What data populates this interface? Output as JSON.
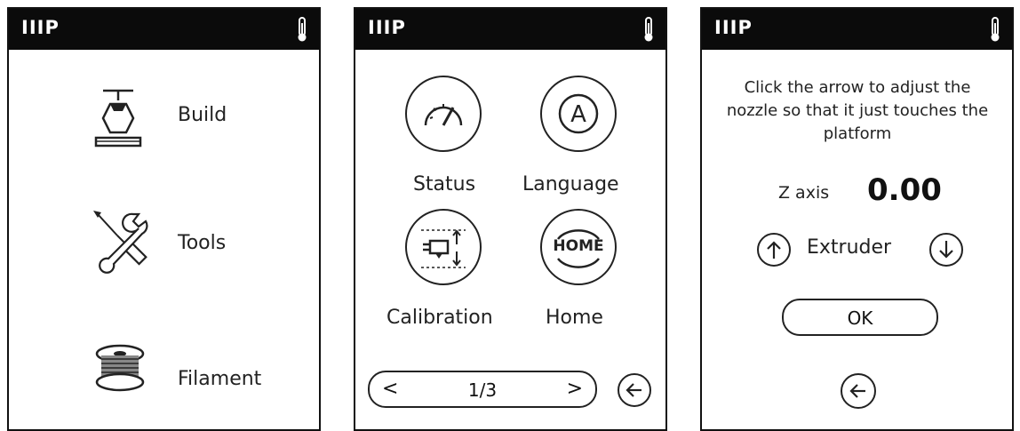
{
  "status_bar": {
    "brand": "IIIP",
    "thermometer_icon": "thermometer-icon"
  },
  "screen1": {
    "items": [
      {
        "label": "Build",
        "icon": "nozzle-build-icon"
      },
      {
        "label": "Tools",
        "icon": "wrench-screwdriver-icon"
      },
      {
        "label": "Filament",
        "icon": "filament-spool-icon"
      }
    ]
  },
  "screen2": {
    "items": [
      {
        "label": "Status",
        "icon": "gauge-icon"
      },
      {
        "label": "Language",
        "icon": "letter-a-icon"
      },
      {
        "label": "Calibration",
        "icon": "calibration-icon"
      },
      {
        "label": "Home",
        "icon": "home-text-icon",
        "icon_text": "HOME"
      }
    ],
    "pager": {
      "prev": "<",
      "page": "1/3",
      "next": ">"
    },
    "back_icon": "back-arrow-icon"
  },
  "screen3": {
    "instruction": "Click the arrow to adjust the nozzle so that it just touches the platform",
    "axis_label": "Z axis",
    "axis_value": "0.00",
    "extruder_label": "Extruder",
    "ok_label": "OK",
    "up_icon": "arrow-up-icon",
    "down_icon": "arrow-down-icon",
    "back_icon": "back-arrow-icon"
  }
}
